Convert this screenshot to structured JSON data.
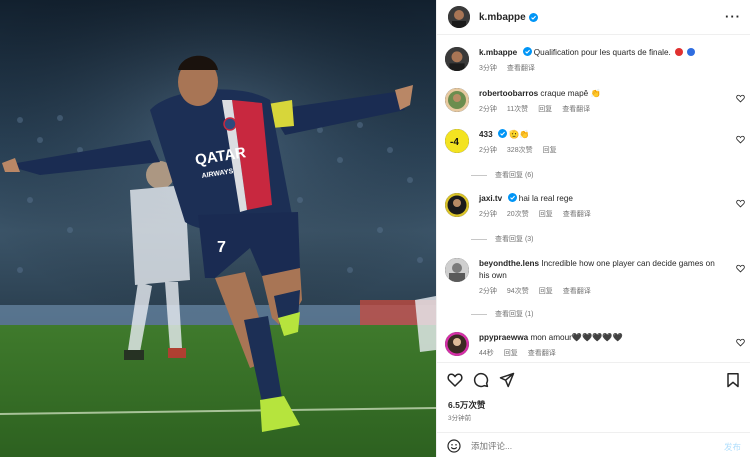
{
  "header": {
    "username": "k.mbappe",
    "more_label": "···"
  },
  "caption": {
    "username": "k.mbappe",
    "text": "Qualification pour les quarts de finale.",
    "time": "3分钟",
    "translate": "查看翻译"
  },
  "comments": [
    {
      "username": "robertoobarros",
      "text": "craque mapê 👏",
      "time": "2分钟",
      "likes": "11次赞",
      "reply": "回复",
      "translate": "查看翻译",
      "verified": false
    },
    {
      "username": "433",
      "text": "🫡👏",
      "time": "2分钟",
      "likes": "328次赞",
      "reply": "回复",
      "translate": "",
      "verified": true,
      "view_replies": "查看回复 (6)"
    },
    {
      "username": "jaxi.tv",
      "text": "hai la real rege",
      "time": "2分钟",
      "likes": "20次赞",
      "reply": "回复",
      "translate": "查看翻译",
      "verified": true,
      "view_replies": "查看回复 (3)"
    },
    {
      "username": "beyondthe.lens",
      "text": "Incredible how one player can decide games on his own",
      "time": "2分钟",
      "likes": "94次赞",
      "reply": "回复",
      "translate": "查看翻译",
      "verified": false,
      "view_replies": "查看回复 (1)"
    },
    {
      "username": "ppypraewwa",
      "text": "mon amour🖤🖤🖤🖤🖤",
      "time": "44秒",
      "likes": "",
      "reply": "回复",
      "translate": "查看翻译",
      "verified": false
    }
  ],
  "stats": {
    "likes": "6.5万次赞",
    "time_ago": "3分钟前"
  },
  "composer": {
    "placeholder": "添加评论...",
    "post_label": "发布"
  },
  "media": {
    "jersey_sponsor": "QATAR AIRWAYS",
    "jersey_number": "7"
  },
  "icons": [
    "heart-icon",
    "comment-icon",
    "share-icon",
    "save-icon",
    "emoji-icon",
    "verified-icon",
    "more-icon"
  ],
  "colors": {
    "verified": "#0095f6",
    "text": "#262626",
    "secondary": "#737373",
    "border": "#efefef",
    "post_disabled": "#b2dffc"
  }
}
